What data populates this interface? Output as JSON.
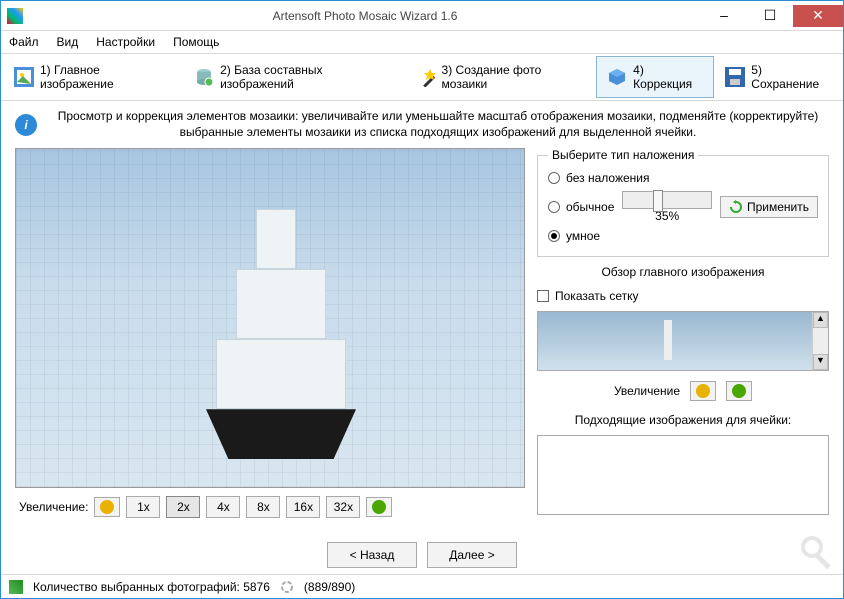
{
  "window": {
    "title": "Artensoft Photo Mosaic Wizard 1.6"
  },
  "menu": {
    "file": "Файл",
    "view": "Вид",
    "settings": "Настройки",
    "help": "Помощь"
  },
  "steps": {
    "s1": "1) Главное изображение",
    "s2": "2) База составных изображений",
    "s3": "3) Создание фото мозаики",
    "s4": "4) Коррекция",
    "s5": "5) Сохранение"
  },
  "info": "Просмотр и коррекция элементов мозаики: увеличивайте или уменьшайте масштаб отображения мозаики, подменяйте (корректируйте) выбранные элементы мозаики из списка подходящих изображений для выделенной ячейки.",
  "zoom": {
    "label": "Увеличение:",
    "levels": [
      "1x",
      "2x",
      "4x",
      "8x",
      "16x",
      "32x"
    ],
    "selected": "2x"
  },
  "overlay": {
    "legend": "Выберите тип наложения",
    "none": "без наложения",
    "normal": "обычное",
    "smart": "умное",
    "percent": "35%",
    "apply": "Применить"
  },
  "overview": {
    "title": "Обзор главного изображения",
    "grid": "Показать сетку",
    "zoom": "Увеличение"
  },
  "fit": {
    "title": "Подходящие изображения для ячейки:"
  },
  "nav": {
    "back": "< Назад",
    "next": "Далее >"
  },
  "status": {
    "label": "Количество выбранных фотографий: 5876",
    "progress": "(889/890)"
  }
}
